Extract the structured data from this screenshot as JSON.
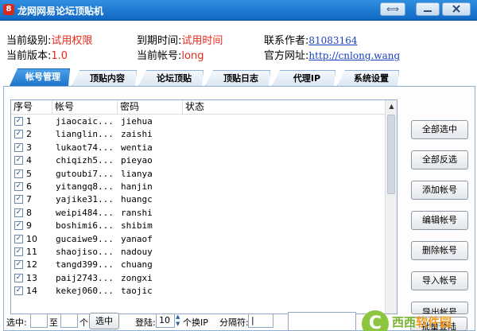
{
  "window": {
    "title": "龙网网易论坛顶贴机",
    "icon_char": "8",
    "restore_glyph": "⟺",
    "minimize_glyph": "",
    "close_glyph": ""
  },
  "info": {
    "level_label": "当前级别:",
    "level_value": "试用权限",
    "expire_label": "到期时间:",
    "expire_value": "试用时间",
    "author_label": "联系作者:",
    "author_value": "81083164",
    "version_label": "当前版本:",
    "version_value": "1.0",
    "account_label": "当前帐号:",
    "account_value": "long",
    "site_label": "官方网址:",
    "site_value": "http://cnlong.wang"
  },
  "tabs": [
    {
      "label": "帐号管理",
      "active": true
    },
    {
      "label": "顶贴内容",
      "active": false
    },
    {
      "label": "论坛顶贴",
      "active": false
    },
    {
      "label": "顶贴日志",
      "active": false
    },
    {
      "label": "代理IP",
      "active": false
    },
    {
      "label": "系统设置",
      "active": false
    }
  ],
  "table": {
    "columns": [
      "序号",
      "帐号",
      "密码",
      "状态"
    ],
    "rows": [
      {
        "checked": true,
        "num": "1",
        "account": "jiaocaic...",
        "password": "jiehua",
        "status": ""
      },
      {
        "checked": true,
        "num": "2",
        "account": "lianglin...",
        "password": "zaishi",
        "status": ""
      },
      {
        "checked": true,
        "num": "3",
        "account": "lukaot74...",
        "password": "wentia",
        "status": ""
      },
      {
        "checked": true,
        "num": "4",
        "account": "chiqizh5...",
        "password": "pieyao",
        "status": ""
      },
      {
        "checked": true,
        "num": "5",
        "account": "gutoubi7...",
        "password": "lianya",
        "status": ""
      },
      {
        "checked": true,
        "num": "6",
        "account": "yitangq8...",
        "password": "hanjin",
        "status": ""
      },
      {
        "checked": true,
        "num": "7",
        "account": "yajike31...",
        "password": "huangc",
        "status": ""
      },
      {
        "checked": true,
        "num": "8",
        "account": "weipi484...",
        "password": "ranshi",
        "status": ""
      },
      {
        "checked": true,
        "num": "9",
        "account": "boshimi6...",
        "password": "shibim",
        "status": ""
      },
      {
        "checked": true,
        "num": "10",
        "account": "gucaiwe9...",
        "password": "yanaof",
        "status": ""
      },
      {
        "checked": true,
        "num": "11",
        "account": "shaojiso...",
        "password": "nadouy",
        "status": ""
      },
      {
        "checked": true,
        "num": "12",
        "account": "tangd399...",
        "password": "chuang",
        "status": ""
      },
      {
        "checked": true,
        "num": "13",
        "account": "paij2743...",
        "password": "zongxi",
        "status": ""
      },
      {
        "checked": true,
        "num": "14",
        "account": "kekej060...",
        "password": "taojic",
        "status": ""
      }
    ]
  },
  "side_buttons": [
    "全部选中",
    "全部反选",
    "添加帐号",
    "编辑帐号",
    "删除帐号",
    "导入帐号",
    "导出帐号"
  ],
  "bottom": {
    "select_label": "选中:",
    "to_label": "至",
    "unit_label": "个",
    "select_button": "选中",
    "login_label": "登陆:",
    "login_count": "10",
    "switch_ip_label": "个换IP",
    "separator_label": "分隔符:",
    "separator_value": "|",
    "batch_login_button": "批量登陆"
  },
  "watermark": {
    "icon_char": "C",
    "text_green": "西西",
    "text_orange": "软件园"
  }
}
